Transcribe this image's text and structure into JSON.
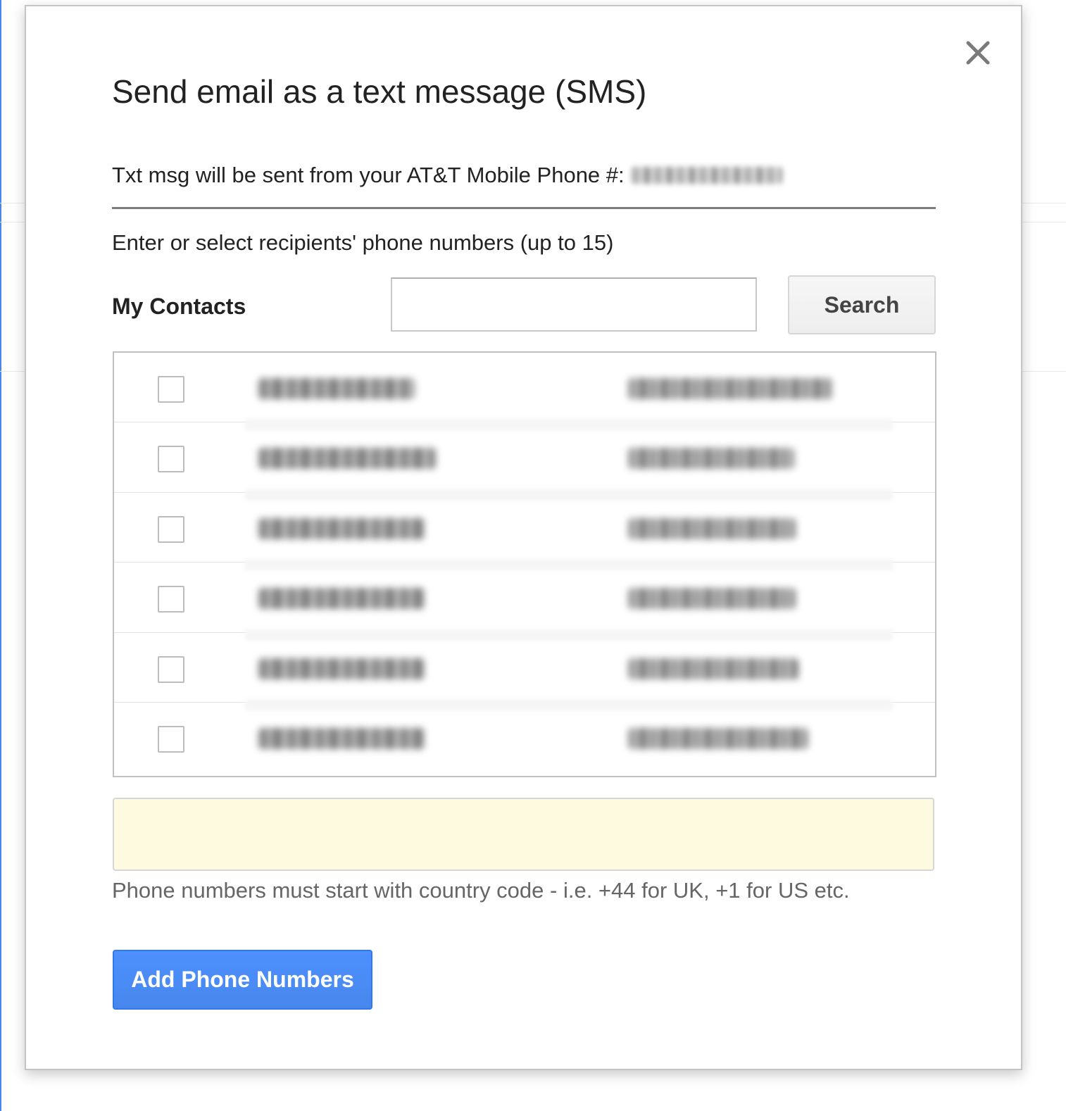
{
  "dialog": {
    "title": "Send email as a text message (SMS)",
    "from_label": "Txt msg will be sent from your AT&T Mobile Phone #:",
    "instructions": "Enter or select recipients' phone numbers (up to 15)",
    "contacts_label": "My Contacts",
    "search_button": "Search",
    "search_placeholder": "",
    "recipients_value": "",
    "hint": "Phone numbers must start with country code - i.e. +44 for UK, +1 for US etc.",
    "add_button": "Add Phone Numbers"
  },
  "contacts": [
    {
      "checked": false
    },
    {
      "checked": false
    },
    {
      "checked": false
    },
    {
      "checked": false
    },
    {
      "checked": false
    },
    {
      "checked": false
    }
  ],
  "colors": {
    "accent_button": "#4d90fe",
    "recipients_background": "#fdfadf",
    "left_edge": "#4a86e8"
  },
  "icons": {
    "close": "close-icon"
  }
}
